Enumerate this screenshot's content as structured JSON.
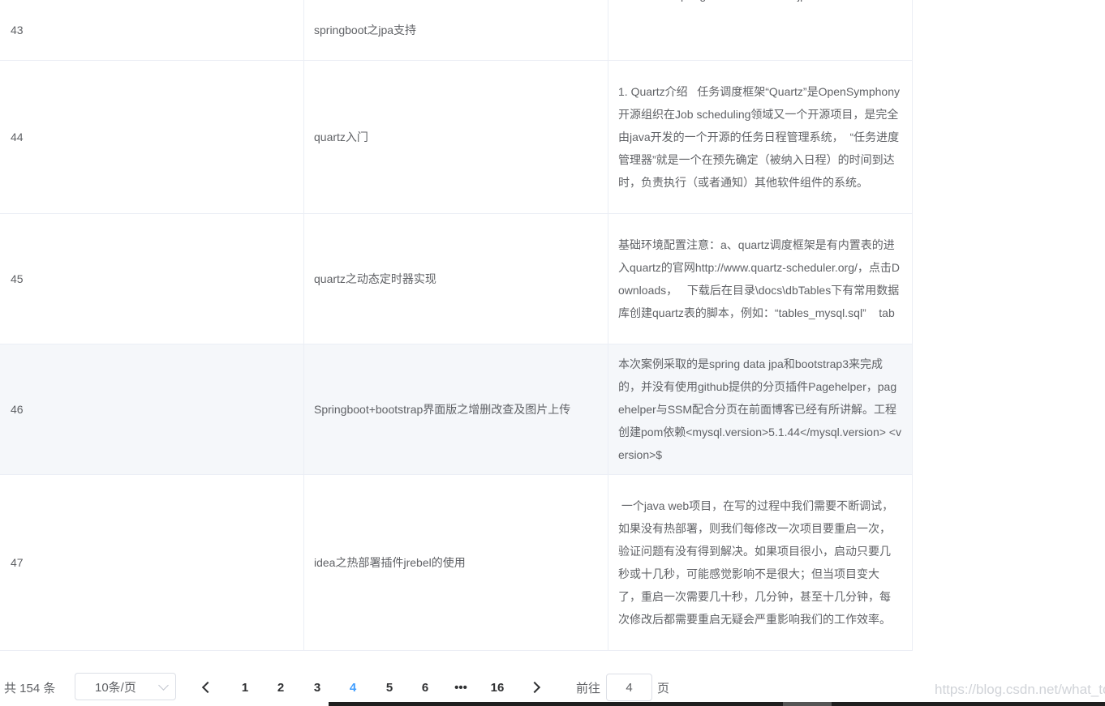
{
  "rows": [
    {
      "id": "43",
      "title": "springboot之jpa支持",
      "summary": "<groupId>org.springframework.boot</groupId>\n<artifactId>spring-boot-starter-data-jpa</artifactId> </d"
    },
    {
      "id": "44",
      "title": "quartz入门",
      "summary": "1. Quartz介绍   任务调度框架“Quartz”是OpenSymphony开源组织在Job scheduling领域又一个开源项目，是完全由java开发的一个开源的任务日程管理系统，  “任务进度管理器”就是一个在预先确定（被纳入日程）的时间到达时，负责执行（或者通知）其他软件组件的系统。"
    },
    {
      "id": "45",
      "title": "quartz之动态定时器实现",
      "summary": "基础环境配置注意：a、quartz调度框架是有内置表的进入quartz的官网http://www.quartz-scheduler.org/，点击Downloads，   下载后在目录\\docs\\dbTables下有常用数据库创建quartz表的脚本，例如：“tables_mysql.sql”    tab"
    },
    {
      "id": "46",
      "title": "Springboot+bootstrap界面版之增删改查及图片上传",
      "summary": "本次案例采取的是spring data jpa和bootstrap3来完成的，并没有使用github提供的分页插件Pagehelper，pagehelper与SSM配合分页在前面博客已经有所讲解。工程创建pom依赖<mysql.version>5.1.44</mysql.version> <version>$"
    },
    {
      "id": "47",
      "title": "idea之热部署插件jrebel的使用",
      "summary": " 一个java web项目，在写的过程中我们需要不断调试，如果没有热部署，则我们每修改一次项目要重启一次，验证问题有没有得到解决。如果项目很小，启动只要几秒或十几秒，可能感觉影响不是很大；但当项目变大了，重启一次需要几十秒，几分钟，甚至十几分钟，每次修改后都需要重启无疑会严重影响我们的工作效率。"
    }
  ],
  "pagination": {
    "total_text": "共 154 条",
    "page_size": "10条/页",
    "pages": [
      "1",
      "2",
      "3",
      "4",
      "5",
      "6",
      "•••",
      "16"
    ],
    "current_page": "4",
    "goto_label": "前往",
    "goto_value": "4",
    "goto_suffix": "页"
  },
  "watermark": "https://blog.csdn.net/what_to",
  "colors": {
    "accent": "#409eff",
    "row_hover": "#f5f7fa",
    "border": "#ebeef5",
    "text": "#606266"
  }
}
